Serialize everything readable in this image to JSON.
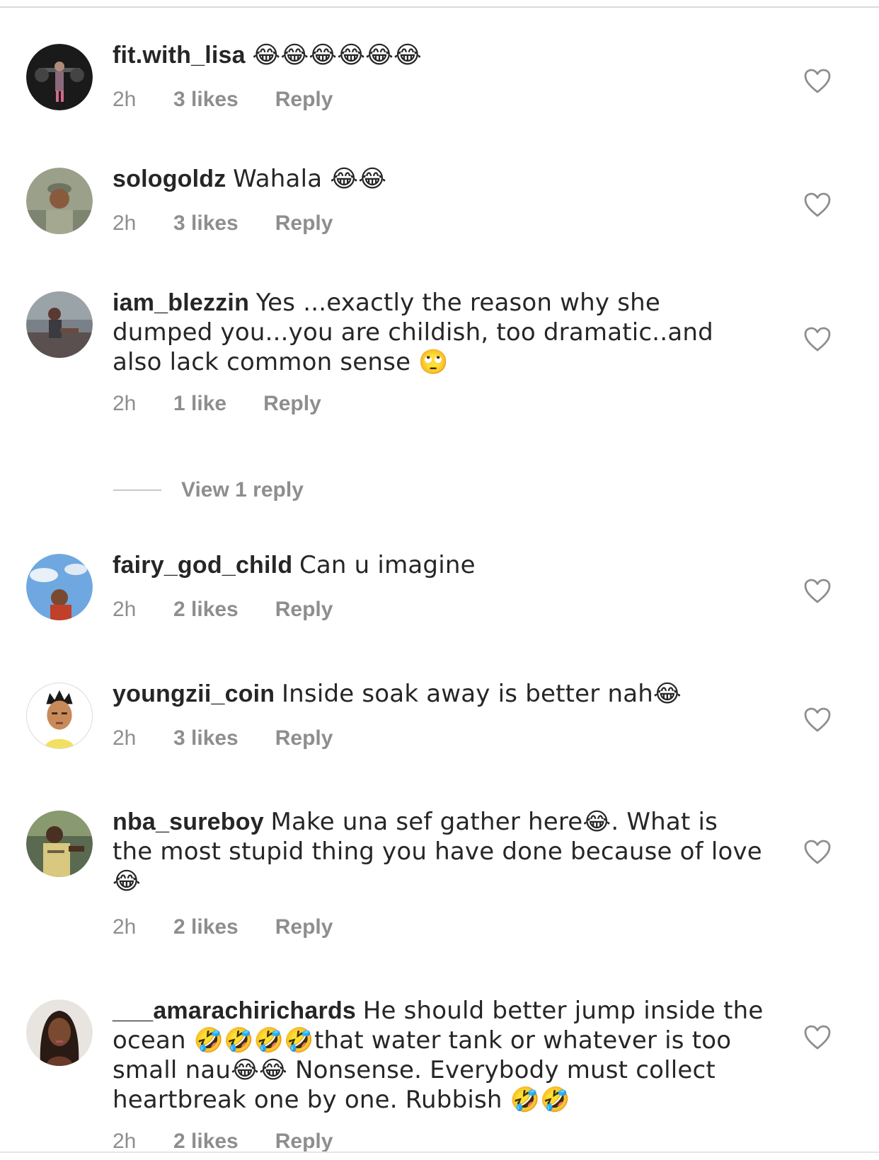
{
  "comments": [
    {
      "username": "fit.with_lisa",
      "text": "😂😂😂😂😂😂",
      "time": "2h",
      "likes": "3 likes",
      "reply": "Reply"
    },
    {
      "username": "sologoldz",
      "text": "Wahala 😂😂",
      "time": "2h",
      "likes": "3 likes",
      "reply": "Reply"
    },
    {
      "username": "iam_blezzin",
      "text": "Yes ...exactly the reason why she dumped you...you are childish, too dramatic..and also lack common sense 🙄",
      "time": "2h",
      "likes": "1 like",
      "reply": "Reply",
      "view_replies": "View 1 reply"
    },
    {
      "username": "fairy_god_child",
      "text": "Can u imagine",
      "time": "2h",
      "likes": "2 likes",
      "reply": "Reply"
    },
    {
      "username": "youngzii_coin",
      "text": "Inside soak away is better nah😂",
      "time": "2h",
      "likes": "3 likes",
      "reply": "Reply"
    },
    {
      "username": "nba_sureboy",
      "text": "Make una sef gather here😂. What is the most stupid thing you have done  because of love 😂",
      "time": "2h",
      "likes": "2 likes",
      "reply": "Reply"
    },
    {
      "username": "___amarachirichards",
      "text": "He should better jump inside the ocean 🤣🤣🤣🤣that water tank or whatever is too small nau😂😂 Nonsense. Everybody must collect heartbreak one by one. Rubbish 🤣🤣",
      "time": "2h",
      "likes": "2 likes",
      "reply": "Reply"
    }
  ],
  "icons": {
    "heart": "heart-outline-icon"
  },
  "colors": {
    "text": "#262626",
    "meta": "#8e8e8e",
    "divider": "#dbdbdb"
  }
}
